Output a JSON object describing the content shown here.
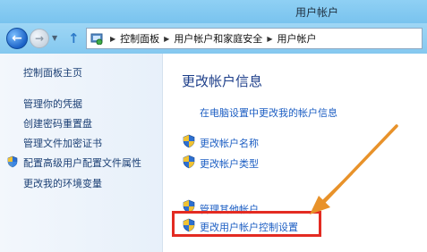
{
  "window": {
    "title": "用户帐户"
  },
  "address_bar": {
    "crumbs": [
      "控制面板",
      "用户帐户和家庭安全",
      "用户帐户"
    ]
  },
  "left_pane": {
    "links": [
      "控制面板主页",
      "管理你的凭据",
      "创建密码重置盘",
      "管理文件加密证书",
      "配置高级用户配置文件属性",
      "更改我的环境变量"
    ]
  },
  "main": {
    "heading": "更改帐户信息",
    "links": {
      "change_in_pc_settings": "在电脑设置中更改我的帐户信息",
      "change_account_name": "更改帐户名称",
      "change_account_type": "更改帐户类型",
      "manage_other_account": "管理其他帐户",
      "change_uac_settings": "更改用户帐户控制设置"
    }
  },
  "annotation": {
    "highlight_color": "#e32b22",
    "arrow_color": "#e8922a"
  }
}
